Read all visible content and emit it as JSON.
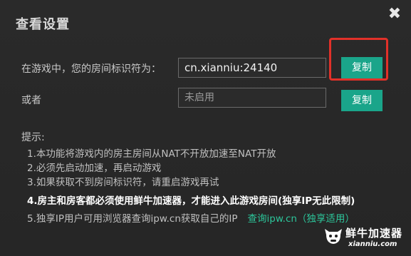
{
  "dialog": {
    "title": "查看设置",
    "close_symbol": "✖"
  },
  "room": {
    "label": "在游戏中，您的房间标识符为：",
    "value": "cn.xianniu:24140",
    "copy_label": "复制"
  },
  "alt": {
    "label": "或者",
    "value": "未启用",
    "copy_label": "复制"
  },
  "tips": {
    "title": "提示:",
    "items": [
      "1.本功能将游戏内的房主房间从NAT不开放加速至NAT开放",
      "2.必须先启动加速，再启动游戏",
      "3.如果获取不到房间标识符，请重启游戏再试",
      "4.房主和房客都必须使用鲜牛加速器，才能进入此游戏房间(独享IP无此限制)",
      "5.独享IP用户可用浏览器查询ipw.cn获取自己的IP"
    ],
    "link": "查询ipw.cn（独享适用）"
  },
  "watermark": {
    "brand": "鲜牛加速器",
    "domain": "xianniu.com",
    "icon": "cow-logo-icon"
  },
  "colors": {
    "accent": "#1aa58a",
    "highlight_border": "#e23129",
    "link": "#2cc59a"
  }
}
